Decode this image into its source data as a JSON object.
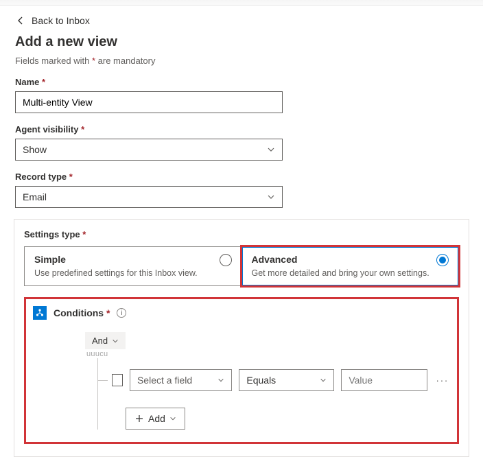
{
  "back_link": "Back to Inbox",
  "page_title": "Add a new view",
  "mandatory_prefix": "Fields marked with ",
  "mandatory_asterisk": "*",
  "mandatory_suffix": " are mandatory",
  "fields": {
    "name": {
      "label": "Name",
      "value": "Multi-entity View"
    },
    "agent_visibility": {
      "label": "Agent visibility",
      "value": "Show"
    },
    "record_type": {
      "label": "Record type",
      "value": "Email"
    }
  },
  "settings_type": {
    "label": "Settings type",
    "simple": {
      "title": "Simple",
      "desc": "Use predefined settings for this Inbox view."
    },
    "advanced": {
      "title": "Advanced",
      "desc": "Get more detailed and bring your own settings."
    },
    "selected": "advanced"
  },
  "conditions": {
    "label": "Conditions",
    "logic": "And",
    "stub": "uuucu",
    "row": {
      "field_placeholder": "Select a field",
      "operator": "Equals",
      "value_placeholder": "Value"
    },
    "add_label": "Add"
  }
}
